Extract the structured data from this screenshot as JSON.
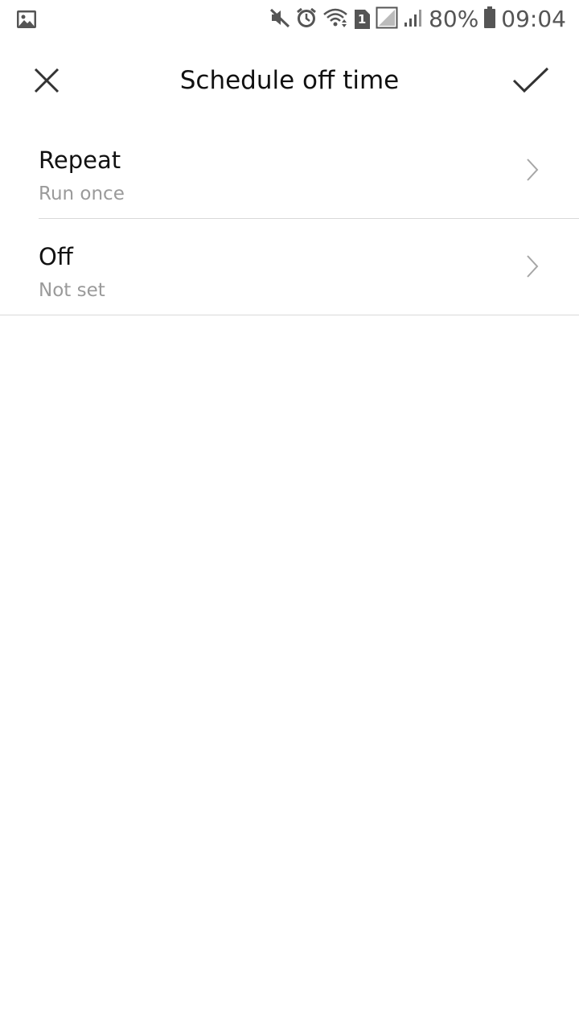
{
  "status_bar": {
    "battery_percent": "80%",
    "time": "09:04",
    "sim_badge": "1",
    "icons": [
      "gallery-icon",
      "mute-icon",
      "alarm-icon",
      "wifi-icon",
      "sim-icon",
      "no-signal-icon",
      "signal-icon",
      "battery-icon"
    ]
  },
  "app_bar": {
    "title": "Schedule off time",
    "close_icon": "close-icon",
    "done_icon": "check-icon"
  },
  "settings": [
    {
      "title": "Repeat",
      "subtitle": "Run once"
    },
    {
      "title": "Off",
      "subtitle": "Not set"
    }
  ],
  "colors": {
    "background": "#ffffff",
    "text_primary": "#111111",
    "text_secondary": "#9a9a9a",
    "divider": "#d9d9d9",
    "icon": "#333333"
  }
}
